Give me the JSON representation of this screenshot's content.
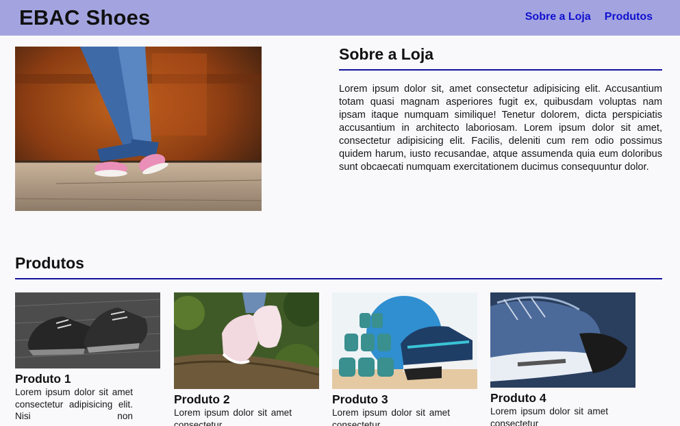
{
  "header": {
    "brand": "EBAC Shoes",
    "nav": [
      "Sobre a Loja",
      "Produtos"
    ]
  },
  "about": {
    "title": "Sobre a Loja",
    "text": "Lorem ipsum dolor sit, amet consectetur adipisicing elit. Accusantium totam quasi magnam asperiores fugit ex, quibusdam voluptas nam ipsam itaque numquam similique! Tenetur dolorem, dicta perspiciatis accusantium in architecto laboriosam. Lorem ipsum dolor sit amet, consectetur adipisicing elit. Facilis, deleniti cum rem odio possimus quidem harum, iusto recusandae, atque assumenda quia eum doloribus sunt obcaecati numquam exercitationem ducimus consequuntur dolor."
  },
  "produtos": {
    "title": "Produtos",
    "items": [
      {
        "name": "Produto 1",
        "text": "Lorem ipsum dolor sit amet consectetur adipisicing elit. Nisi non"
      },
      {
        "name": "Produto 2",
        "text": "Lorem ipsum dolor sit amet consectetur"
      },
      {
        "name": "Produto 3",
        "text": "Lorem ipsum dolor sit amet consectetur"
      },
      {
        "name": "Produto 4",
        "text": "Lorem ipsum dolor sit amet consectetur"
      }
    ]
  },
  "colors": {
    "header_bg": "#a3a4df",
    "nav_link": "#1010d0",
    "divider": "#10109a"
  }
}
